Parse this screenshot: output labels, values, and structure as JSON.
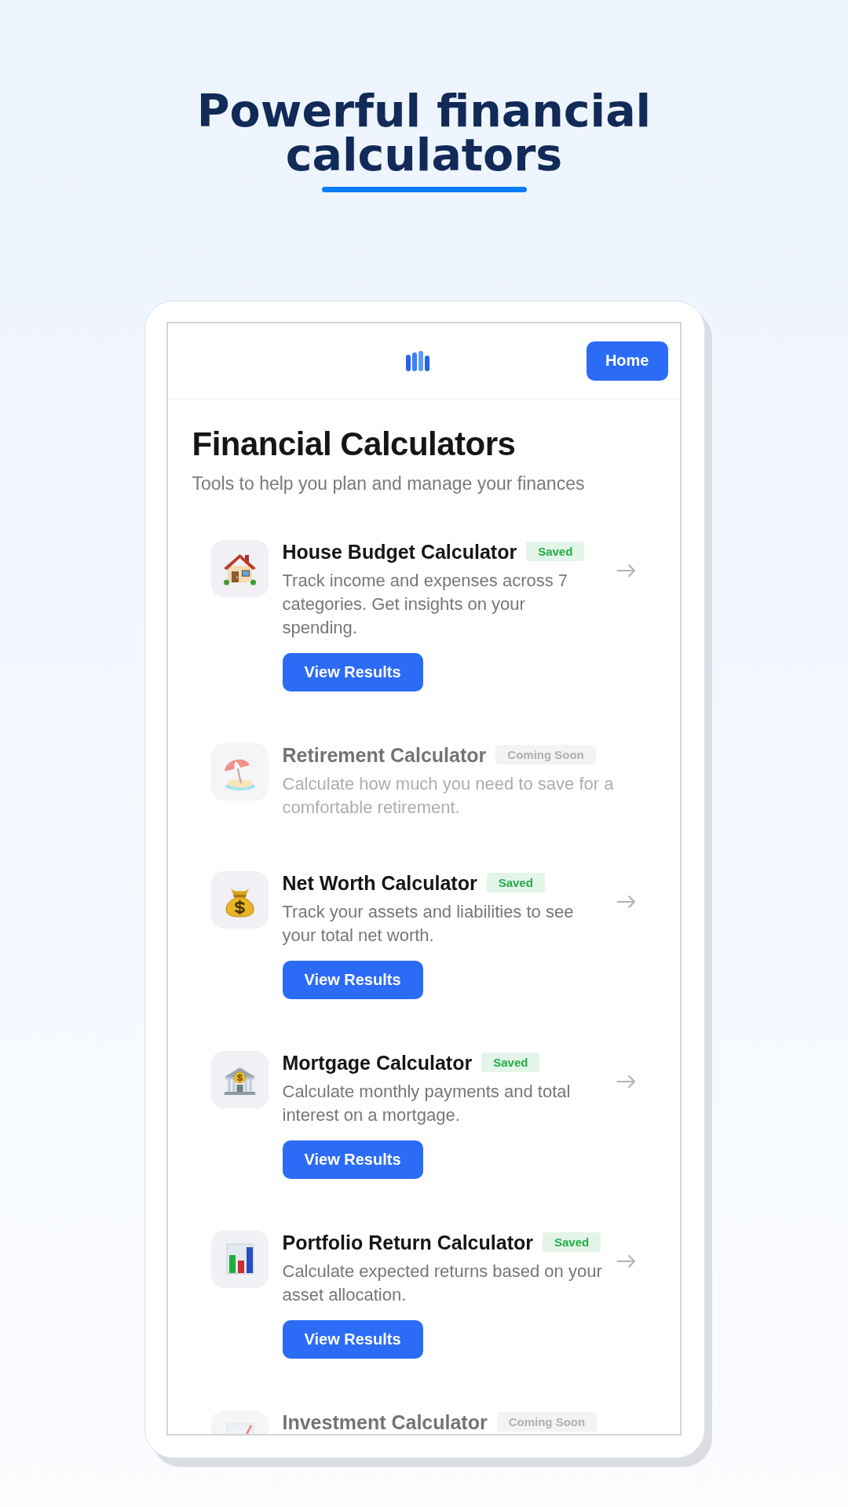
{
  "hero": {
    "title": "Powerful financial calculators"
  },
  "app": {
    "nav": {
      "home_button": "Home"
    },
    "heading": "Financial Calculators",
    "subtitle": "Tools to help you plan and manage your finances",
    "calculators": [
      {
        "title": "House Budget Calculator",
        "badge": "Saved",
        "disabled": false,
        "description": "Track income and expenses across 7 categories. Get insights on your spending.",
        "button": "View Results"
      },
      {
        "title": "Retirement Calculator",
        "badge": "Coming Soon",
        "disabled": true,
        "description": "Calculate how much you need to save for a comfortable retirement."
      },
      {
        "title": "Net Worth Calculator",
        "badge": "Saved",
        "disabled": false,
        "description": "Track your assets and liabilities to see your total net worth.",
        "button": "View Results"
      },
      {
        "title": "Mortgage Calculator",
        "badge": "Saved",
        "disabled": false,
        "description": "Calculate monthly payments and total interest on a mortgage.",
        "button": "View Results"
      },
      {
        "title": "Portfolio Return Calculator",
        "badge": "Saved",
        "disabled": false,
        "description": "Calculate expected returns based on your asset allocation.",
        "button": "View Results"
      },
      {
        "title": "Investment Calculator",
        "badge": "Coming Soon",
        "disabled": true
      }
    ]
  }
}
